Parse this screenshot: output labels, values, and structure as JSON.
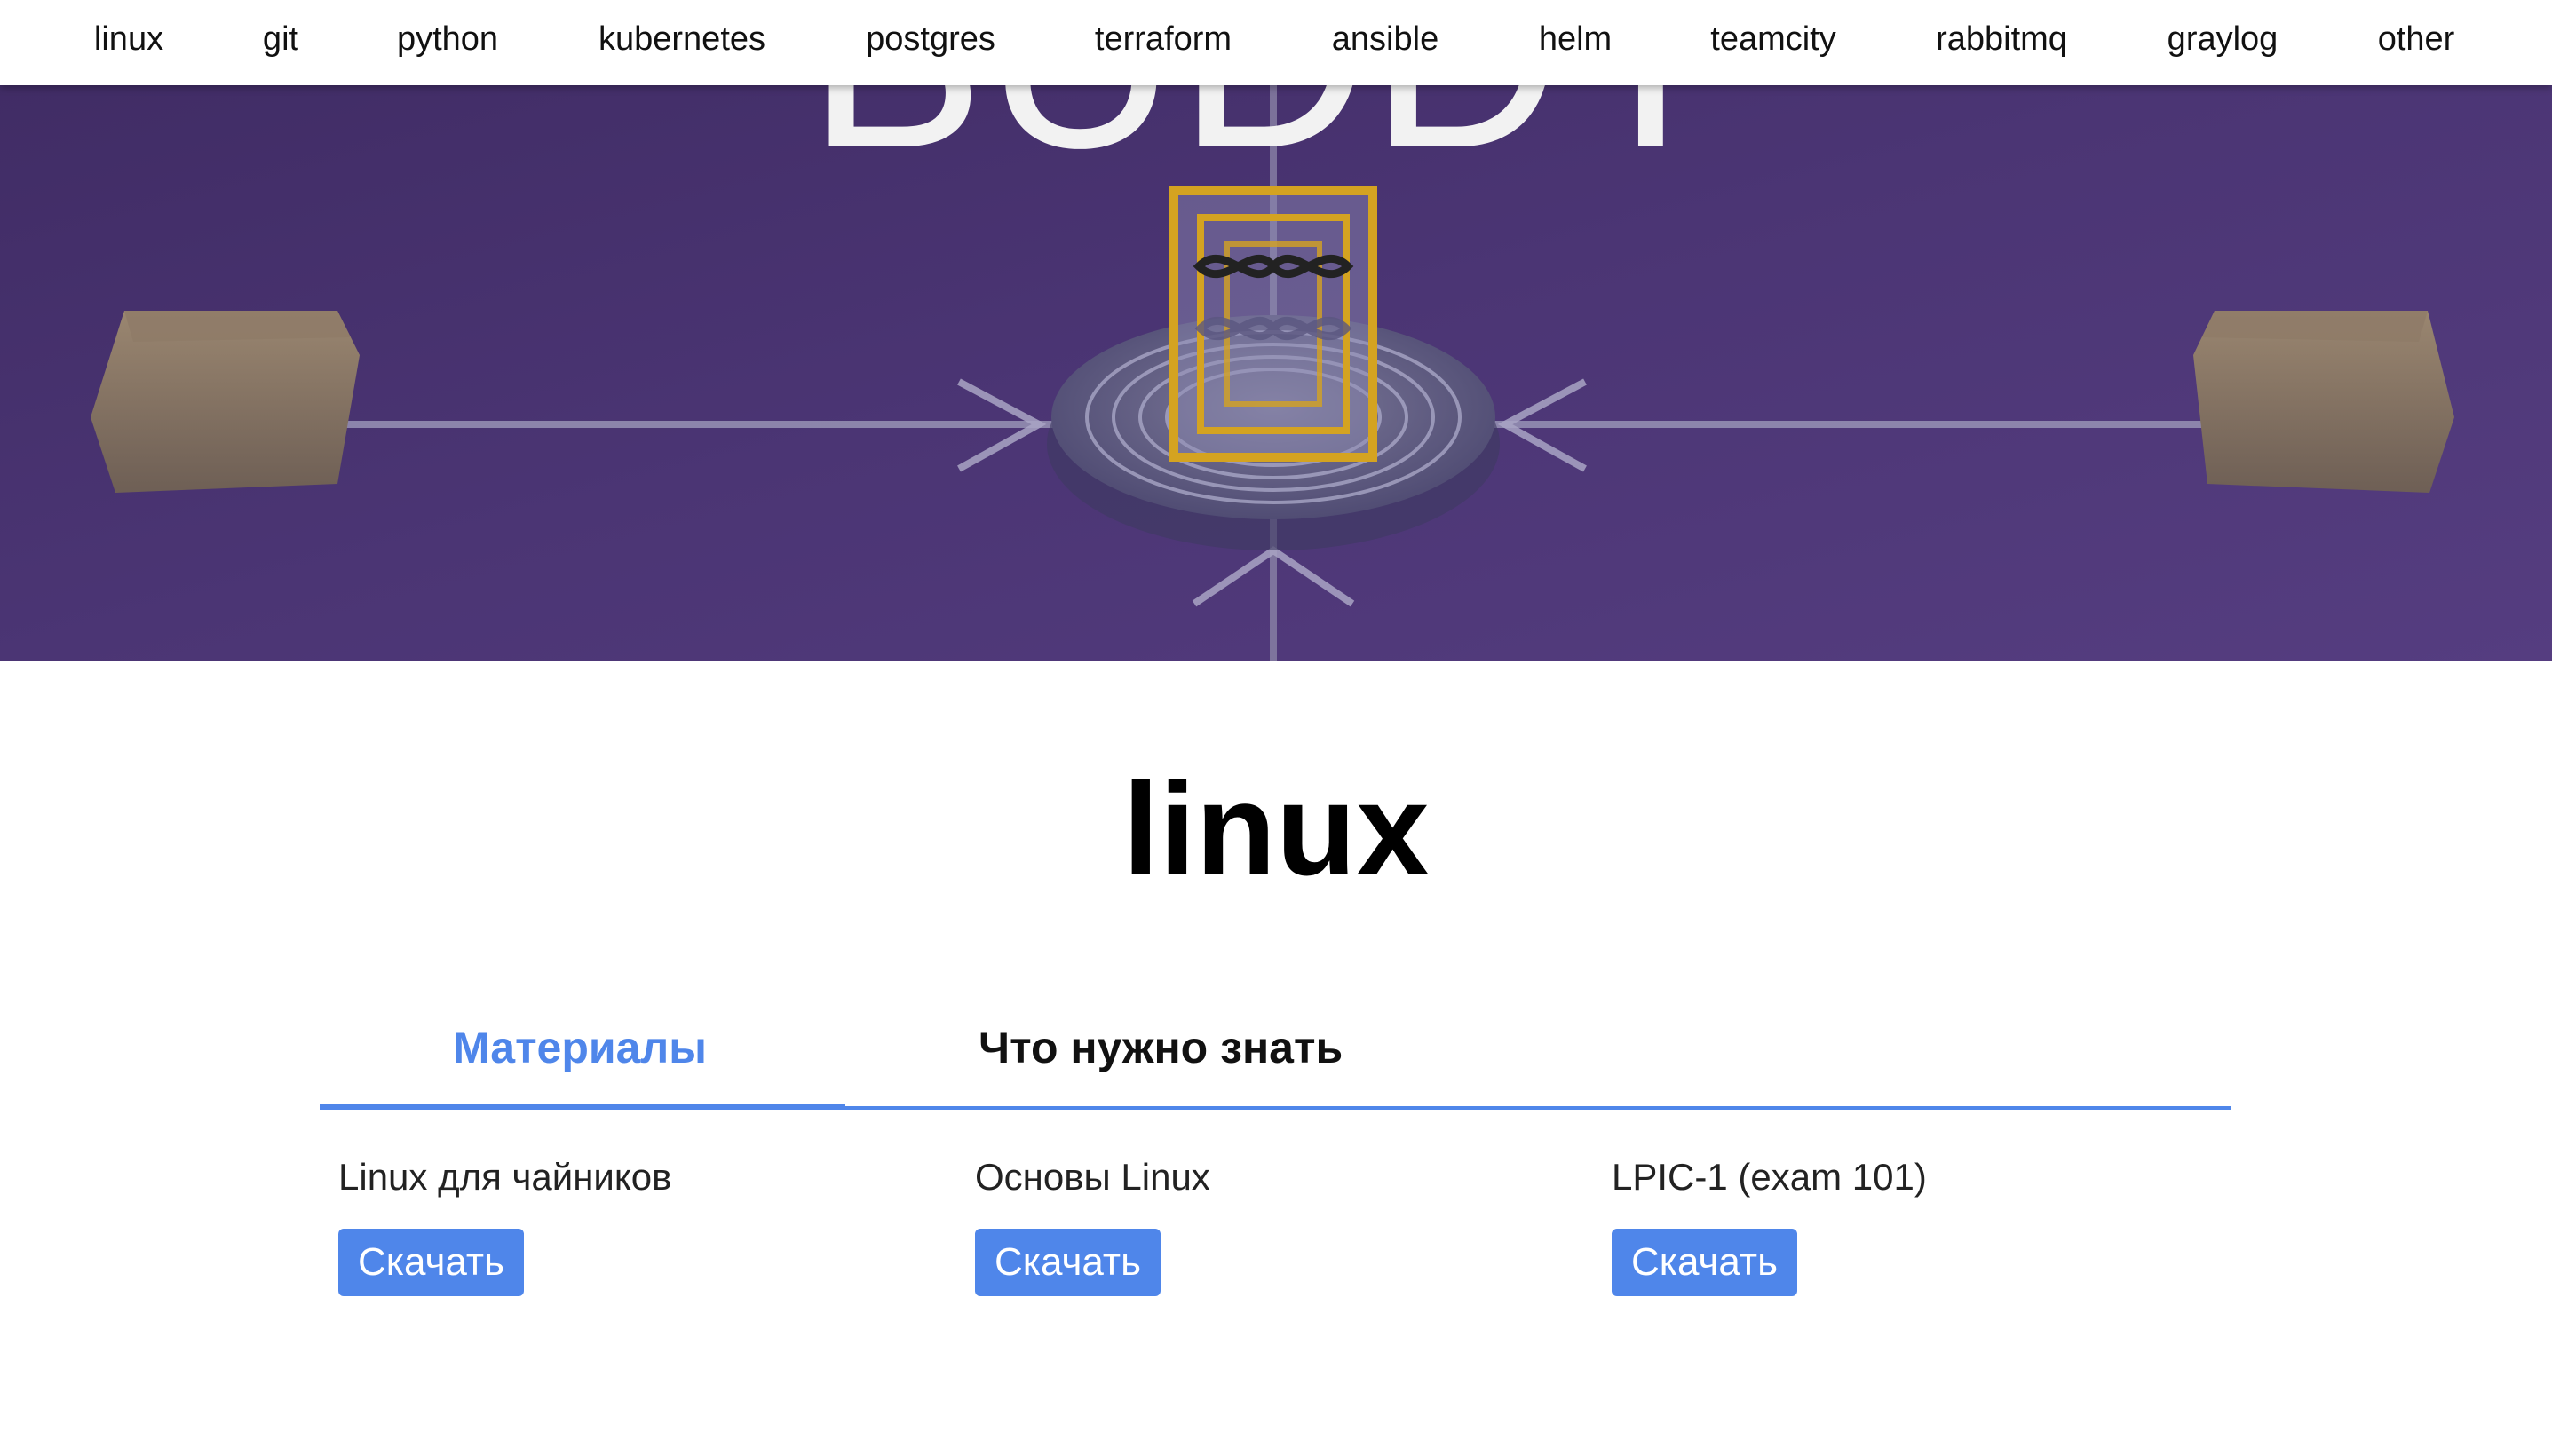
{
  "nav": {
    "items": [
      {
        "label": "linux"
      },
      {
        "label": "git"
      },
      {
        "label": "python"
      },
      {
        "label": "kubernetes"
      },
      {
        "label": "postgres"
      },
      {
        "label": "terraform"
      },
      {
        "label": "ansible"
      },
      {
        "label": "helm"
      },
      {
        "label": "teamcity"
      },
      {
        "label": "rabbitmq"
      },
      {
        "label": "graylog"
      },
      {
        "label": "other"
      }
    ]
  },
  "hero": {
    "logo_text": "BUDDY",
    "background_color": "#4a3470"
  },
  "page": {
    "title": "linux"
  },
  "tabs": [
    {
      "label": "Материалы",
      "active": true
    },
    {
      "label": "Что нужно знать",
      "active": false
    }
  ],
  "materials": [
    {
      "title": "Linux для чайников",
      "button_label": "Скачать"
    },
    {
      "title": "Основы Linux",
      "button_label": "Скачать"
    },
    {
      "title": "LPIC-1 (exam 101)",
      "button_label": "Скачать"
    }
  ],
  "colors": {
    "accent": "#4f86ea",
    "text": "#111111"
  }
}
